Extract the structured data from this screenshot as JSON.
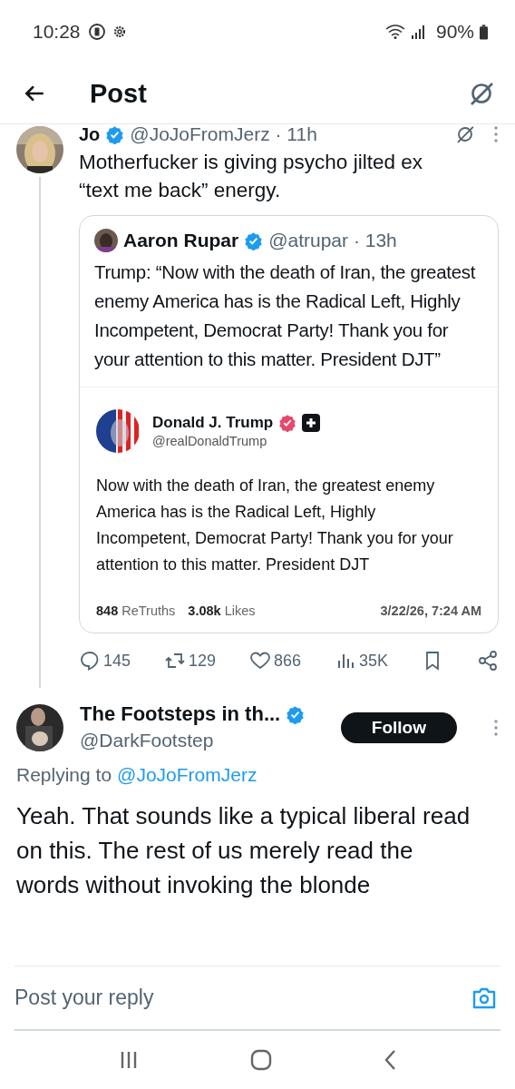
{
  "status_bar": {
    "time": "10:28",
    "battery": "90%"
  },
  "header": {
    "title": "Post"
  },
  "post": {
    "name": "Jo",
    "verified": true,
    "handle": "@JoJoFromJerz · 11h",
    "text": "Motherfucker is giving psycho jilted ex “text me back” energy.",
    "quote": {
      "name": "Aaron Rupar",
      "verified": true,
      "handle": "@atrupar · 13h",
      "text": "Trump: “Now with the death of Iran, the greatest enemy America has is the Radical Left, Highly Incompetent, Democrat Party! Thank you for your attention to this matter. President DJT”",
      "embed": {
        "name": "Donald J. Trump",
        "handle": "@realDonaldTrump",
        "text": "Now with the death of Iran, the greatest enemy America has is the Radical Left, Highly Incompetent, Democrat Party! Thank you for your attention to this matter. President DJT",
        "stats": [
          {
            "count": "848",
            "label": "ReTruths"
          },
          {
            "count": "3.08k",
            "label": "Likes"
          }
        ],
        "timestamp": "3/22/26, 7:24 AM"
      }
    },
    "actions": [
      {
        "kind": "reply",
        "count": "145"
      },
      {
        "kind": "repost",
        "count": "129"
      },
      {
        "kind": "like",
        "count": "866"
      },
      {
        "kind": "views",
        "count": "35K"
      },
      {
        "kind": "bookmark"
      },
      {
        "kind": "share"
      }
    ]
  },
  "reply": {
    "name": "The Footsteps in th...",
    "verified": true,
    "handle": "@DarkFootstep",
    "follow_label": "Follow",
    "replying_prefix": "Replying to",
    "replying_to": "@JoJoFromJerz",
    "text": "Yeah. That sounds like a typical liberal read on this. The rest of us merely read the words without invoking the blonde"
  },
  "composer": {
    "placeholder": "Post your reply"
  }
}
